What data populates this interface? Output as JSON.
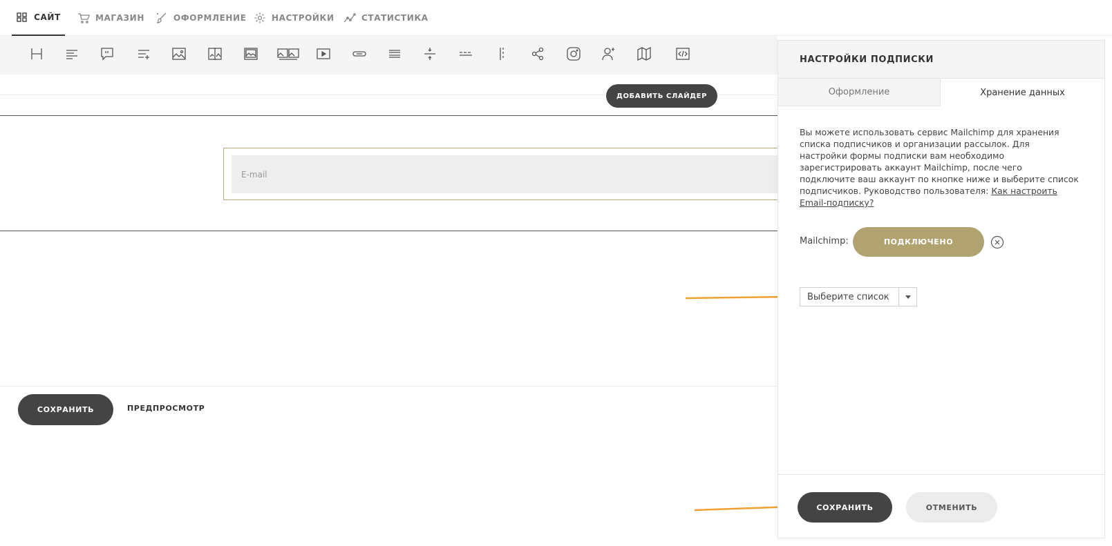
{
  "nav": {
    "items": [
      {
        "label": "САЙТ",
        "icon": "grid-icon",
        "active": true
      },
      {
        "label": "МАГАЗИН",
        "icon": "cart-icon"
      },
      {
        "label": "ОФОРМЛЕНИЕ",
        "icon": "brush-icon"
      },
      {
        "label": "НАСТРОЙКИ",
        "icon": "gear-icon"
      },
      {
        "label": "СТАТИСТИКА",
        "icon": "stats-icon"
      }
    ]
  },
  "toolbar": {
    "icons": [
      "heading-icon",
      "text-icon",
      "quote-icon",
      "list-icon",
      "image-icon",
      "image-compare-icon",
      "image-frame-icon",
      "gallery-icon",
      "video-icon",
      "button-icon",
      "menu-icon",
      "divider-space-icon",
      "dashed-divider-icon",
      "vertical-divider-icon",
      "share-icon",
      "instagram-icon",
      "subscribe-icon",
      "map-icon",
      "code-icon"
    ]
  },
  "canvas": {
    "add_slider_label": "ДОБАВИТЬ СЛАЙДЕР",
    "email_placeholder": "E-mail",
    "save_label": "СОХРАНИТЬ",
    "preview_label": "ПРЕДПРОСМОТР"
  },
  "panel": {
    "title": "НАСТРОЙКИ ПОДПИСКИ",
    "tabs": [
      "Оформление",
      "Хранение данных"
    ],
    "description": "Вы можете использовать сервис Mailchimp для хранения списка подписчиков и организации рассылок. Для настройки формы подписки вам необходимо зарегистрировать аккаунт Mailchimp, после чего подключите ваш аккаунт по кнопке ниже и выберите список подписчиков. Руководство пользователя: ",
    "guide_link": "Как настроить Email-подписку?",
    "mailchimp_label": "Mailchimp:",
    "connected_label": "ПОДКЛЮЧЕНО",
    "select_value": "Выберите список",
    "save_label": "СОХРАНИТЬ",
    "cancel_label": "ОТМЕНИТЬ"
  },
  "colors": {
    "accent_gold": "#b0a370",
    "dark_button": "#444444",
    "arrow_orange": "#f0a030"
  }
}
